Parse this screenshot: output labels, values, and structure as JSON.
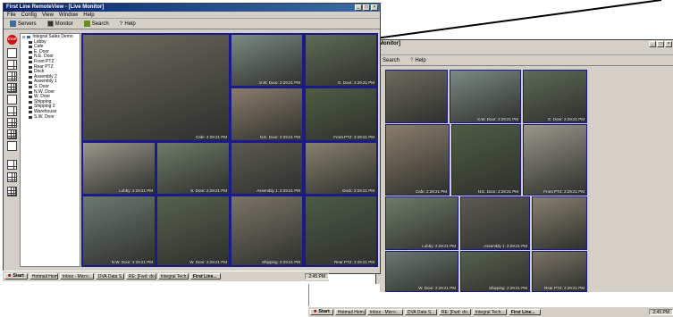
{
  "front_window": {
    "title": "First Line RemoteView - [Live Monitor]",
    "menu": [
      "File",
      "Config",
      "View",
      "Window",
      "Help"
    ],
    "toolbar": [
      "Servers",
      "Monitor",
      "Search",
      "Help"
    ]
  },
  "back_window": {
    "title": "Monitor]",
    "toolbar": [
      "Search",
      "Help"
    ]
  },
  "tree": {
    "root": "Integral Sales Demo",
    "cameras": [
      "Lobby",
      "Cafe",
      "E. Door",
      "N.E. Door",
      "Front PTZ",
      "Rear PTZ",
      "Dock",
      "Assembly 2",
      "Assembly 1",
      "S. Door",
      "N.W. Door",
      "W. Door",
      "Shipping",
      "Shipping 2",
      "Warehouse",
      "S.W. Door"
    ]
  },
  "front_cams": [
    {
      "stamp": "Cafe: 2:29:21 PM"
    },
    {
      "stamp": "S.W. Door: 2:29:21 PM"
    },
    {
      "stamp": "E. Door: 2:29:21 PM"
    },
    {
      "stamp": "N.E. Door: 2:29:21 PM"
    },
    {
      "stamp": "Front PTZ: 2:29:21 PM"
    },
    {
      "stamp": "Lobby: 2:29:21 PM"
    },
    {
      "stamp": "S. Door: 2:29:21 PM"
    },
    {
      "stamp": "Assembly 1: 2:29:21 PM"
    },
    {
      "stamp": "Dock: 2:29:21 PM"
    },
    {
      "stamp": "N.W. Door: 2:29:21 PM"
    },
    {
      "stamp": "W. Door: 2:29:21 PM"
    },
    {
      "stamp": "Shipping: 2:29:21 PM"
    },
    {
      "stamp": "Rear PTZ: 2:29:21 PM"
    }
  ],
  "back_cams": [
    {
      "stamp": ""
    },
    {
      "stamp": "S.W. Door: 2:29:21 PM"
    },
    {
      "stamp": "E. Door: 2:29:21 PM"
    },
    {
      "stamp": "Cafe: 2:29:21 PM"
    },
    {
      "stamp": "N.E. Door: 2:29:21 PM"
    },
    {
      "stamp": "Front PTZ: 2:29:21 PM"
    },
    {
      "stamp": "Lobby: 2:29:21 PM"
    },
    {
      "stamp": "Assembly 1: 2:29:21 PM"
    },
    {
      "stamp": ""
    },
    {
      "stamp": "W. Door: 2:29:21 PM"
    },
    {
      "stamp": "Shipping: 2:29:21 PM"
    },
    {
      "stamp": "Rear PTZ: 2:29:21 PM"
    }
  ],
  "front_taskbar": {
    "start": "Start",
    "tasks": [
      "Hotmail Hom...",
      "Inbox - Micro...",
      "DVA Data S...",
      "RE: [Fwd: do...",
      "Integral Tech...",
      "First Line..."
    ],
    "clock": "2:45 PM"
  },
  "back_taskbar": {
    "start": "Start",
    "tasks": [
      "Hotmail Hom...",
      "Inbox - Micro...",
      "DVA Data S...",
      "RE: [Fwd: do...",
      "Integral Tech...",
      "First Line..."
    ],
    "clock": "2:45 PM"
  }
}
